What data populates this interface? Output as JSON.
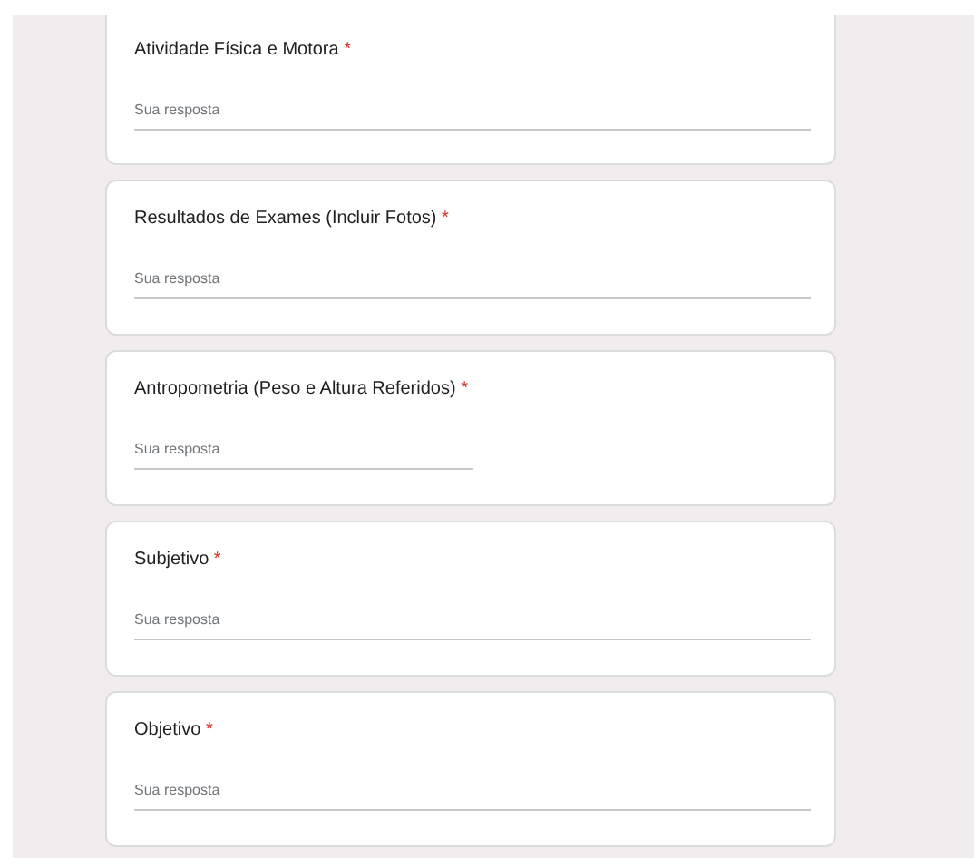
{
  "questions": [
    {
      "title": "Atividade Física e Motora",
      "required_mark": "*",
      "placeholder": "Sua resposta",
      "kind": "long"
    },
    {
      "title": "Resultados de Exames (Incluir Fotos)",
      "required_mark": "*",
      "placeholder": "Sua resposta",
      "kind": "long"
    },
    {
      "title": "Antropometria (Peso e Altura Referidos)",
      "required_mark": "*",
      "placeholder": "Sua resposta",
      "kind": "short"
    },
    {
      "title": "Subjetivo",
      "required_mark": "*",
      "placeholder": "Sua resposta",
      "kind": "long"
    },
    {
      "title": "Objetivo",
      "required_mark": "*",
      "placeholder": "Sua resposta",
      "kind": "long"
    }
  ]
}
